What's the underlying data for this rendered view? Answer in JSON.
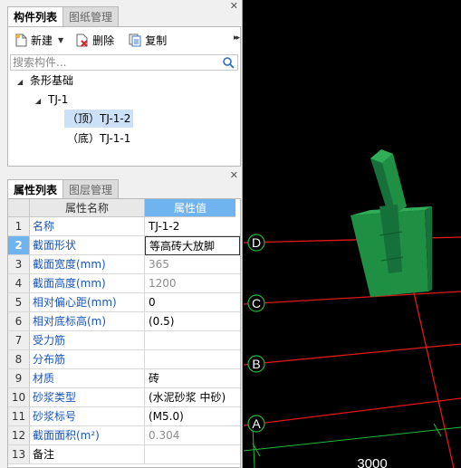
{
  "component_pane": {
    "tabs": [
      "构件列表",
      "图纸管理"
    ],
    "active_tab": 0,
    "toolbar": {
      "new_label": "新建",
      "delete_label": "删除",
      "copy_label": "复制"
    },
    "search": {
      "placeholder": "搜索构件..."
    },
    "tree": {
      "root": "条形基础",
      "child": "TJ-1",
      "items": [
        "（顶）TJ-1-2",
        "（底）TJ-1-1"
      ],
      "selected_index": 0
    }
  },
  "property_pane": {
    "tabs": [
      "属性列表",
      "图层管理"
    ],
    "active_tab": 0,
    "headers": {
      "name": "属性名称",
      "value": "属性值"
    },
    "rows": [
      {
        "num": "1",
        "name": "名称",
        "value": "TJ-1-2",
        "editable": true
      },
      {
        "num": "2",
        "name": "截面形状",
        "value": "等高砖大放脚",
        "editable": true
      },
      {
        "num": "3",
        "name": "截面宽度(mm)",
        "value": "365",
        "editable": false
      },
      {
        "num": "4",
        "name": "截面高度(mm)",
        "value": "1200",
        "editable": false
      },
      {
        "num": "5",
        "name": "相对偏心距(mm)",
        "value": "0",
        "editable": true
      },
      {
        "num": "6",
        "name": "相对底标高(m)",
        "value": "(0.5)",
        "editable": true
      },
      {
        "num": "7",
        "name": "受力筋",
        "value": "",
        "editable": true
      },
      {
        "num": "8",
        "name": "分布筋",
        "value": "",
        "editable": true
      },
      {
        "num": "9",
        "name": "材质",
        "value": "砖",
        "editable": true
      },
      {
        "num": "10",
        "name": "砂浆类型",
        "value": "(水泥砂浆 中砂)",
        "editable": true
      },
      {
        "num": "11",
        "name": "砂浆标号",
        "value": "(M5.0)",
        "editable": true
      },
      {
        "num": "12",
        "name": "截面面积(m²)",
        "value": "0.304",
        "editable": false
      },
      {
        "num": "13",
        "name": "备注",
        "value": "",
        "editable": true,
        "plain": true
      }
    ],
    "selected_row": 1
  },
  "viewport": {
    "axis_labels": [
      "D",
      "C",
      "B",
      "A"
    ],
    "dimension": "3000",
    "colors": {
      "grid": "#e01818",
      "axis_circle": "#21b83a",
      "model_front": "#1f8f43",
      "model_side": "#16703a",
      "model_top": "#2fae57"
    }
  }
}
